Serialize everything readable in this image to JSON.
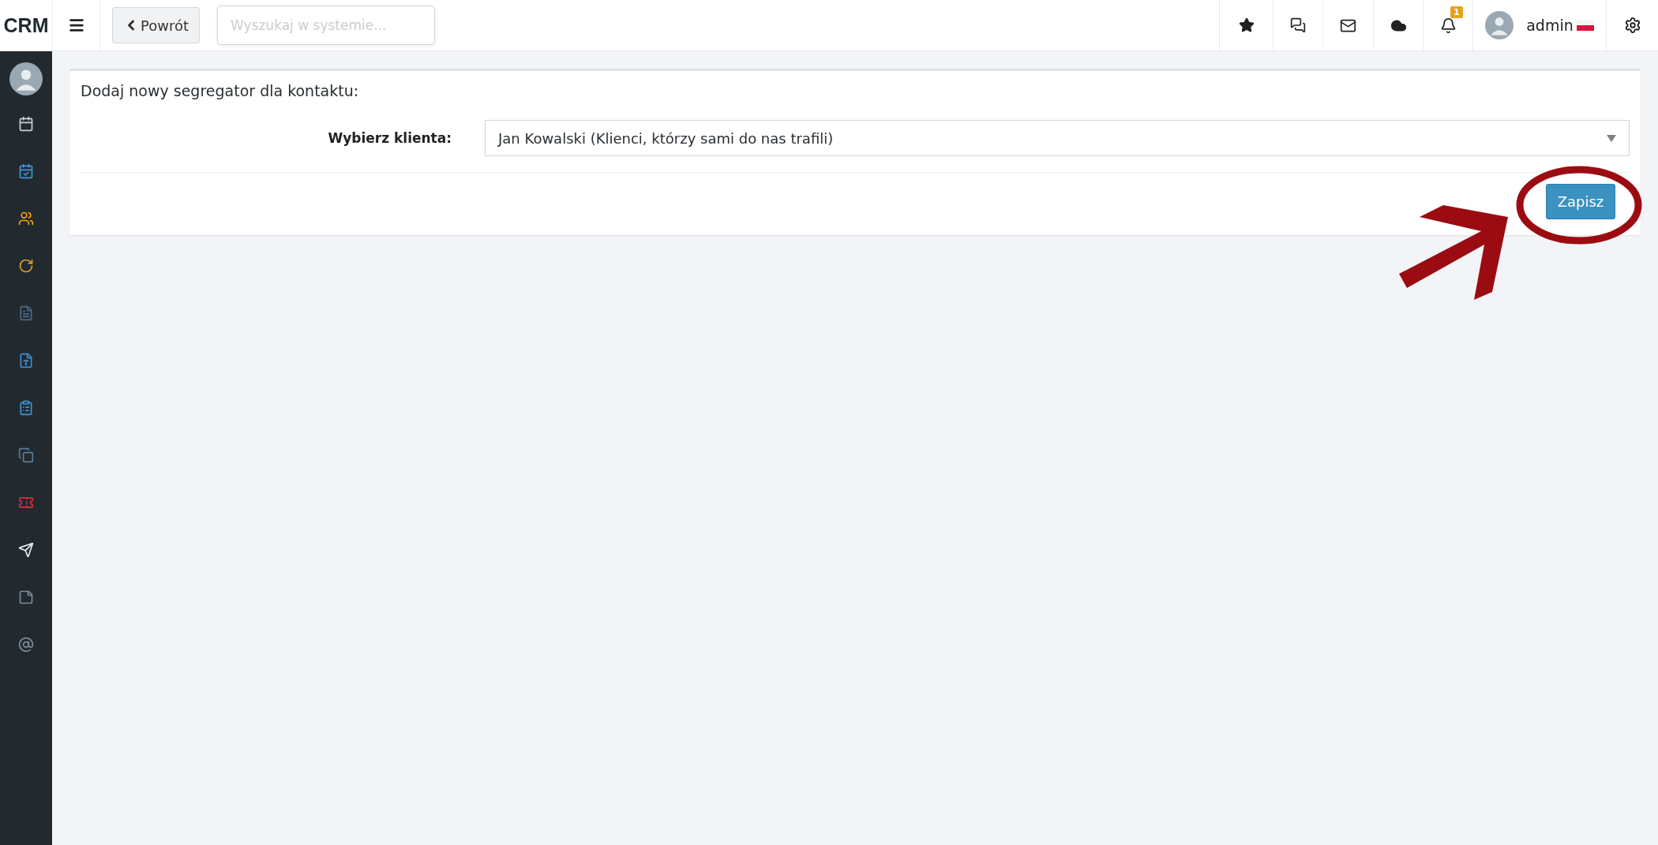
{
  "topbar": {
    "logo": "CRM",
    "back_button": "Powrót",
    "search": {
      "placeholder": "Wyszukaj w systemie..."
    },
    "notifications_badge": "1",
    "user": "admin"
  },
  "sidebar": {
    "items": [
      {
        "color": "#c9d3dc"
      },
      {
        "color": "#3c97d3"
      },
      {
        "color": "#f0a30a"
      },
      {
        "color": "#d9a52e"
      },
      {
        "color": "#4a6a86"
      },
      {
        "color": "#3c8fd0"
      },
      {
        "color": "#3c97d3"
      },
      {
        "color": "#5a7d99"
      },
      {
        "color": "#e0283c"
      },
      {
        "color": "#e8edf2"
      },
      {
        "color": "#7d8c99"
      },
      {
        "color": "#7d8c99"
      }
    ]
  },
  "form": {
    "title": "Dodaj nowy segregator dla kontaktu:",
    "client_label": "Wybierz klienta:",
    "client_value": "Jan Kowalski (Klienci, którzy sami do nas trafili)",
    "submit": "Zapisz"
  }
}
